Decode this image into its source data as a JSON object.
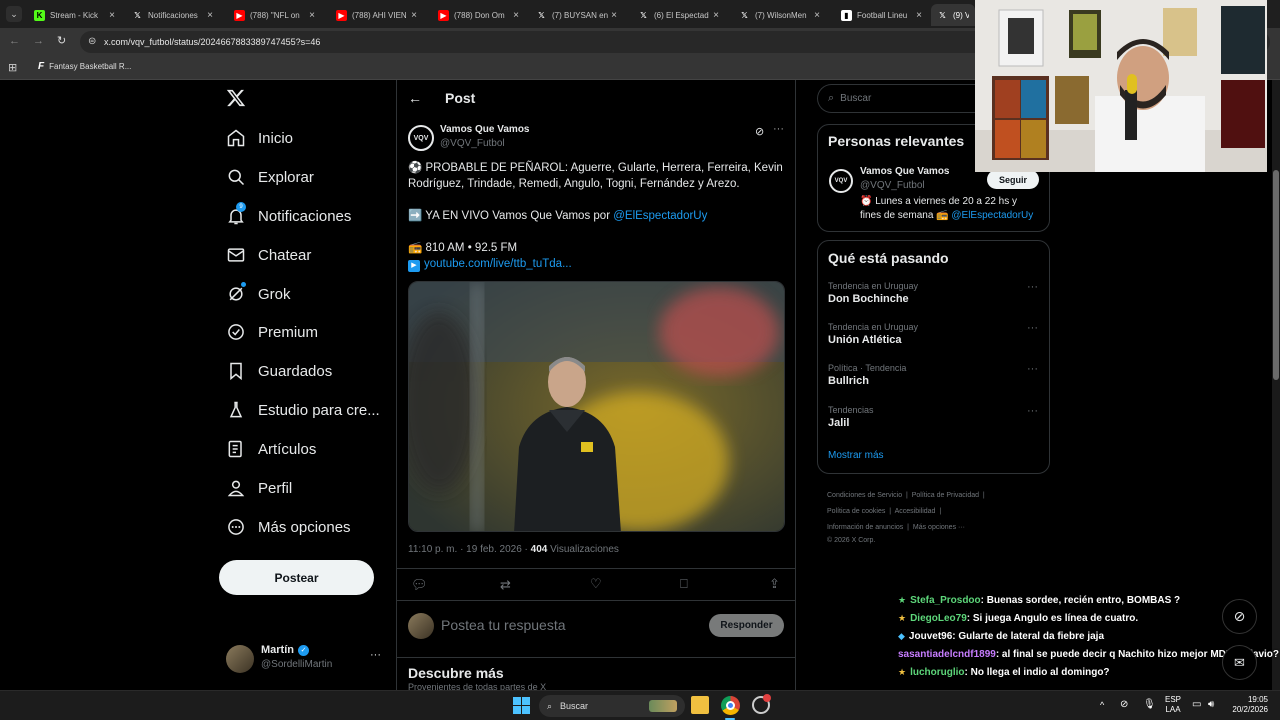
{
  "browser": {
    "tabs": [
      {
        "title": "Stream - Kick",
        "favicon": "kick-icon"
      },
      {
        "title": "Notificaciones",
        "favicon": "x-icon"
      },
      {
        "title": "(788) \"NFL on",
        "favicon": "youtube-icon"
      },
      {
        "title": "(788) AHI VIEN",
        "favicon": "youtube-icon"
      },
      {
        "title": "(788) Don Om",
        "favicon": "youtube-icon"
      },
      {
        "title": "(7) BUYSAN en",
        "favicon": "x-icon"
      },
      {
        "title": "(6) El Espectad",
        "favicon": "x-icon"
      },
      {
        "title": "(7) WilsonMen",
        "favicon": "x-icon"
      },
      {
        "title": "Football Lineu",
        "favicon": "lineup-icon"
      },
      {
        "title": "(9) Va",
        "favicon": "x-icon"
      }
    ],
    "url": "x.com/vqv_futbol/status/2024667883389747455?s=46",
    "bookmark": "Fantasy Basketball R..."
  },
  "nav": {
    "items": [
      {
        "label": "Inicio",
        "icon": "home-icon"
      },
      {
        "label": "Explorar",
        "icon": "search-icon"
      },
      {
        "label": "Notificaciones",
        "icon": "bell-icon",
        "badge": "9"
      },
      {
        "label": "Chatear",
        "icon": "mail-icon"
      },
      {
        "label": "Grok",
        "icon": "grok-icon"
      },
      {
        "label": "Premium",
        "icon": "verified-icon"
      },
      {
        "label": "Guardados",
        "icon": "bookmark-icon"
      },
      {
        "label": "Estudio para cre...",
        "icon": "flask-icon"
      },
      {
        "label": "Artículos",
        "icon": "article-icon"
      },
      {
        "label": "Perfil",
        "icon": "person-icon"
      },
      {
        "label": "Más opciones",
        "icon": "more-circle-icon"
      }
    ],
    "post_button": "Postear",
    "account": {
      "name": "Martín",
      "handle": "@SordelliMartin"
    }
  },
  "post": {
    "header": "Post",
    "author_name": "Vamos Que Vamos",
    "author_handle": "@VQV_Futbol",
    "avatar_text": "VQV",
    "line1": "⚽ PROBABLE DE PEÑAROL: Aguerre, Gularte, Herrera,  Ferreira, Kevin",
    "line2": "Rodríguez, Trindade, Remedi, Angulo, Togni, Fernández y Arezo.",
    "live_prefix": "➡️ YA EN VIVO Vamos Que Vamos por ",
    "live_mention": "@ElEspectadorUy",
    "radio": "📻 810 AM • 92.5 FM",
    "yt_link": "youtube.com/live/ttb_tuTda...",
    "timestamp": "11:10 p. m. · 19 feb. 2026 · ",
    "views_count": "404",
    "views_label": " Visualizaciones",
    "reply_placeholder": "Postea tu respuesta",
    "reply_button": "Responder",
    "discover_title": "Descubre más",
    "discover_sub": "Provenientes de todas partes de X"
  },
  "sidebar": {
    "search_placeholder": "Buscar",
    "relevant_title": "Personas relevantes",
    "relevant": {
      "name": "Vamos Que Vamos",
      "handle": "@VQV_Futbol",
      "follow": "Seguir",
      "bio1": "⏰ Lunes a viernes de 20 a 22 hs y",
      "bio2": "fines de semana 📻 ",
      "bio_mention": "@ElEspectadorUy"
    },
    "trending_title": "Qué está pasando",
    "trends": [
      {
        "category": "Tendencia en Uruguay",
        "name": "Don Bochinche"
      },
      {
        "category": "Tendencia en Uruguay",
        "name": "Unión Atlética"
      },
      {
        "category": "Política · Tendencia",
        "name": "Bullrich"
      },
      {
        "category": "Tendencias",
        "name": "Jalil"
      }
    ],
    "show_more": "Mostrar más",
    "footer": [
      "Condiciones de Servicio",
      "Política de Privacidad",
      "Política de cookies",
      "Accesibilidad",
      "Información de anuncios",
      "Más opciones ···",
      "© 2026 X Corp."
    ]
  },
  "chat": [
    {
      "user": "Stefa_Prosdoo",
      "msg": ": Buenas sordee, recién entro, BOMBAS ?",
      "color": "#5dd67a"
    },
    {
      "user": "DiegoLeo79",
      "msg": ": Si juega Angulo es línea de cuatro.",
      "color": "#5dd67a"
    },
    {
      "user": "Jouvet96",
      "msg": ": Gularte de lateral da fiebre jaja",
      "color": "#ffffff"
    },
    {
      "user": "sasantiadelcndf1899",
      "msg": ": al final se puede decir q Nachito hizo mejor MDP q Flavio?",
      "color": "#c77dff"
    },
    {
      "user": "luchoruglio",
      "msg": ": No llega el indio al domingo?",
      "color": "#5dd67a"
    }
  ],
  "taskbar": {
    "search": "Buscar",
    "lang1": "ESP",
    "lang2": "LAA",
    "time": "19:05",
    "date": "20/2/2026"
  },
  "colors": {
    "accent": "#1d9bf0",
    "background": "#000000",
    "border": "#2f3336",
    "muted": "#71767b"
  }
}
